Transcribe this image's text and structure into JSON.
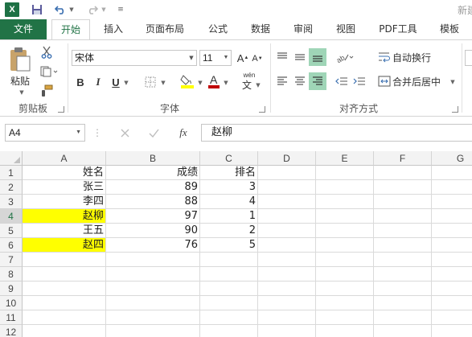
{
  "title": {
    "text": "新建"
  },
  "qat": {
    "excel_icon": "excel-logo-icon",
    "save_icon": "save-icon",
    "undo_icon": "undo-icon",
    "redo_icon": "redo-icon",
    "customize_icon": "customize-qat-icon"
  },
  "tabs": [
    {
      "label": "文件"
    },
    {
      "label": "开始"
    },
    {
      "label": "插入"
    },
    {
      "label": "页面布局"
    },
    {
      "label": "公式"
    },
    {
      "label": "数据"
    },
    {
      "label": "审阅"
    },
    {
      "label": "视图"
    },
    {
      "label": "PDF工具"
    },
    {
      "label": "模板"
    }
  ],
  "ribbon": {
    "clipboard": {
      "paste_label": "粘贴",
      "group_label": "剪贴板"
    },
    "font": {
      "font_name": "宋体",
      "font_size": "11",
      "bold": "B",
      "italic": "I",
      "underline": "U",
      "wen": "wén",
      "wen_char": "文",
      "group_label": "字体",
      "font_color": "#c00000",
      "fill_color": "#ffff00"
    },
    "alignment": {
      "wrap_text": "自动换行",
      "merge_center": "合并后居中",
      "group_label": "对齐方式"
    }
  },
  "formula_bar": {
    "name_box": "A4",
    "fx": "fx",
    "content": "赵柳"
  },
  "grid": {
    "columns": [
      "A",
      "B",
      "C",
      "D",
      "E",
      "F",
      "G"
    ],
    "rows": [
      "1",
      "2",
      "3",
      "4",
      "5",
      "6",
      "7",
      "8",
      "9",
      "10",
      "11",
      "12"
    ],
    "data": [
      {
        "a": "姓名",
        "b": "成绩",
        "c": "排名"
      },
      {
        "a": "张三",
        "b": "89",
        "c": "3"
      },
      {
        "a": "李四",
        "b": "88",
        "c": "4"
      },
      {
        "a": "赵柳",
        "b": "97",
        "c": "1"
      },
      {
        "a": "王五",
        "b": "90",
        "c": "2"
      },
      {
        "a": "赵四",
        "b": "76",
        "c": "5"
      }
    ],
    "highlight_color": "#ffff00"
  }
}
